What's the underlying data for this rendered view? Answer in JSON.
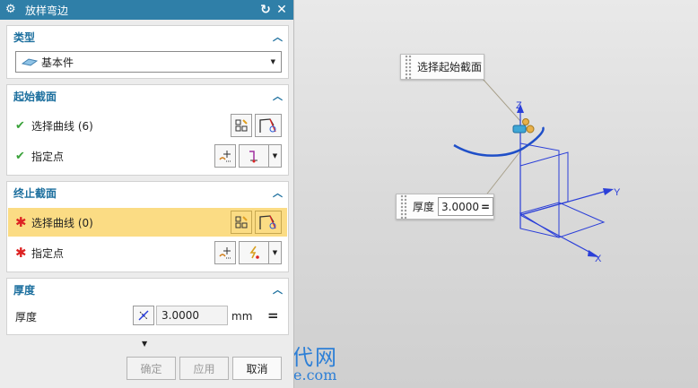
{
  "dialog": {
    "title": "放样弯边",
    "reset_icon": "reset-icon",
    "close_icon": "close-icon",
    "type_section": {
      "title": "类型",
      "selected": "基本件"
    },
    "start_section": {
      "title": "起始截面",
      "curve_label": "选择曲线 (6)",
      "point_label": "指定点"
    },
    "end_section": {
      "title": "终止截面",
      "curve_label": "选择曲线 (0)",
      "point_label": "指定点"
    },
    "thickness_section": {
      "title": "厚度",
      "label": "厚度",
      "value": "3.0000",
      "unit": "mm"
    },
    "buttons": {
      "ok": "确定",
      "apply": "应用",
      "cancel": "取消"
    }
  },
  "viewport": {
    "callout_section": "选择起始截面",
    "callout_thickness_label": "厚度",
    "callout_thickness_value": "3.0000",
    "axis_z": "Z",
    "axis_y": "Y",
    "axis_x": "X"
  },
  "watermark": {
    "title": "机械时代网",
    "url": "www.jxage.com"
  },
  "colors": {
    "title_bar": "#2f7fa8",
    "section_title": "#1c6f9e",
    "highlight": "#fbdc84",
    "required": "#dd2222",
    "check": "#3aa23a",
    "curve": "#1f4fc8"
  }
}
